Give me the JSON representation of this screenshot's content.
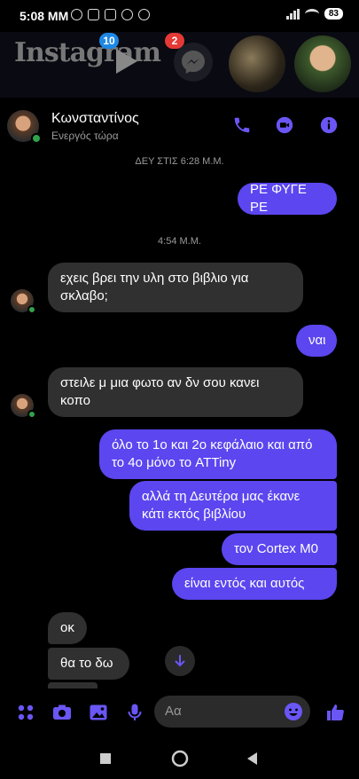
{
  "status_bar": {
    "time": "5:08 MM",
    "battery": "83"
  },
  "background": {
    "app_label": "Instagram",
    "badge_left": "10",
    "badge_right": "2"
  },
  "header": {
    "contact_name": "Κωνσταντίνος",
    "status": "Ενεργός τώρα"
  },
  "conversation": {
    "stamp_1": "ΔΕΥ ΣΤΙΣ 6:28 Μ.Μ.",
    "stamp_2": "4:54 Μ.Μ.",
    "messages": [
      {
        "dir": "out",
        "text": "ΡΕ ΦΥΓΕ ΡΕ"
      },
      {
        "dir": "in",
        "text": "εχεις βρει την υλη στο βιβλιο για σκλαβο;"
      },
      {
        "dir": "out",
        "text": "ναι"
      },
      {
        "dir": "in",
        "text": "στειλε μ μια φωτο αν δν σου κανει κοπο"
      },
      {
        "dir": "out",
        "text": "όλο το 1ο και 2ο κεφάλαιο και από το 4ο μόνο το ATTiny"
      },
      {
        "dir": "out",
        "text": "αλλά τη Δευτέρα μας έκανε κάτι εκτός βιβλίου"
      },
      {
        "dir": "out",
        "text": "τον Cortex M0"
      },
      {
        "dir": "out",
        "text": "είναι εντός και αυτός"
      },
      {
        "dir": "in",
        "text": "οκ"
      },
      {
        "dir": "in",
        "text": "θα το δω"
      }
    ]
  },
  "composer": {
    "placeholder": "Αα"
  },
  "colors": {
    "accent": "#5b46ef",
    "incoming_bubble": "#303030",
    "online": "#31a24c"
  }
}
